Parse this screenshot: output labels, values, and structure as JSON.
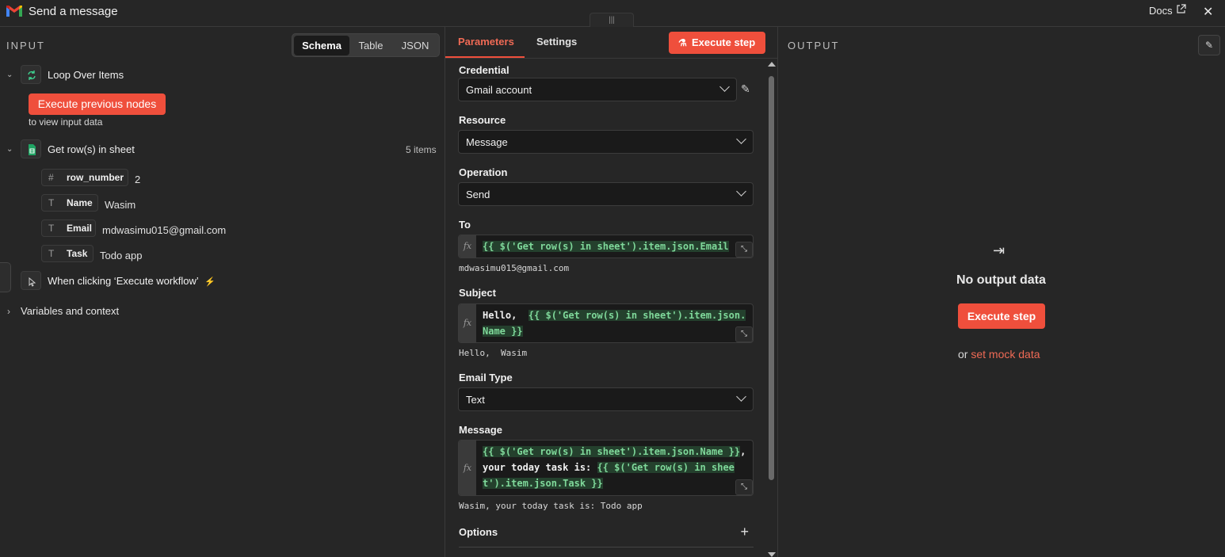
{
  "header": {
    "title": "Send a message",
    "docs_label": "Docs",
    "close_glyph": "✕"
  },
  "input": {
    "label": "INPUT",
    "views": [
      "Schema",
      "Table",
      "JSON"
    ],
    "active_view": "Schema",
    "nodes": {
      "loop": {
        "name": "Loop Over Items",
        "execute_label": "Execute previous nodes",
        "hint": "to view input data"
      },
      "sheet": {
        "name": "Get row(s) in sheet",
        "items_count": "5 items",
        "fields": [
          {
            "type_icon": "#",
            "name": "row_number",
            "value": "2"
          },
          {
            "type_icon": "T",
            "name": "Name",
            "value": "Wasim"
          },
          {
            "type_icon": "T",
            "name": "Email",
            "value": "mdwasimu015@gmail.com"
          },
          {
            "type_icon": "T",
            "name": "Task",
            "value": "Todo app"
          }
        ]
      },
      "trigger": {
        "name": "When clicking ‘Execute workflow’"
      }
    },
    "variables_label": "Variables and context"
  },
  "params": {
    "tabs": {
      "parameters": "Parameters",
      "settings": "Settings"
    },
    "execute_label": "Execute step",
    "credential": {
      "label": "Credential",
      "value": "Gmail account"
    },
    "resource": {
      "label": "Resource",
      "value": "Message"
    },
    "operation": {
      "label": "Operation",
      "value": "Send"
    },
    "to": {
      "label": "To",
      "expression": "{{ $('Get row(s) in sheet').item.json.Email",
      "preview": "mdwasimu015@gmail.com"
    },
    "subject": {
      "label": "Subject",
      "prefix": "Hello,  ",
      "expression": "{{ $('Get row(s) in sheet').item.json.Name }}",
      "preview": "Hello,  Wasim"
    },
    "email_type": {
      "label": "Email Type",
      "value": "Text"
    },
    "message": {
      "label": "Message",
      "expr1": "{{ $('Get row(s) in sheet').item.json.Name }}",
      "middle": ", your today task is: ",
      "expr2": "{{ $('Get row(s) in sheet').item.json.Task }}",
      "preview": "Wasim, your today task is: Todo app"
    },
    "options_label": "Options"
  },
  "output": {
    "label": "OUTPUT",
    "no_output": "No output data",
    "execute_label": "Execute step",
    "or_text": "or",
    "mock_link": "set mock data"
  },
  "colors": {
    "accent": "#ef4f3c",
    "expression_green": "#7fd89a"
  }
}
